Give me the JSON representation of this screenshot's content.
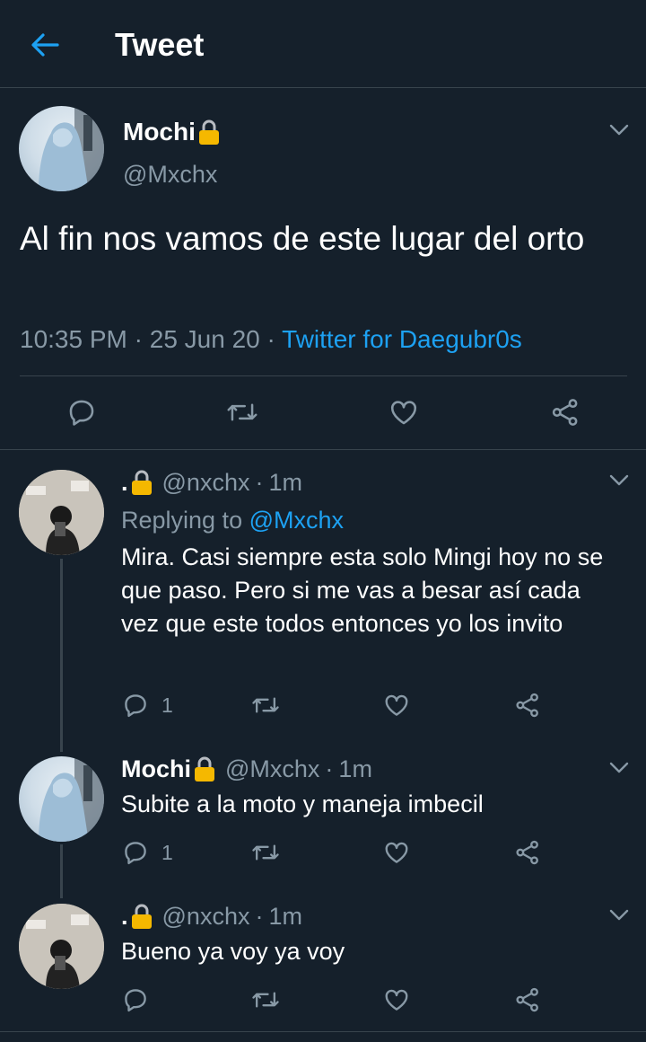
{
  "header": {
    "title": "Tweet",
    "back_icon": "arrow-left-icon"
  },
  "main_tweet": {
    "name": "Mochi",
    "handle": "@Mxchx",
    "text": "Al fin nos vamos de este lugar del orto",
    "time": "10:35 PM",
    "sep": "·",
    "date": "25 Jun 20",
    "source": "Twitter for Daegubr0s"
  },
  "replies": [
    {
      "name": ".",
      "handle": "@nxchx",
      "time": "1m",
      "replying_label": "Replying to",
      "replying_to": "@Mxchx",
      "text": "Mira. Casi siempre esta solo Mingi hoy no se que paso. Pero si me vas a besar así cada vez que este todos entonces yo los invito",
      "reply_count": "1"
    },
    {
      "name": "Mochi",
      "handle": "@Mxchx",
      "time": "1m",
      "text": "Subite a la moto y maneja imbecil",
      "reply_count": "1"
    },
    {
      "name": ".",
      "handle": "@nxchx",
      "time": "1m",
      "text": "Bueno ya voy ya voy",
      "reply_count": ""
    }
  ],
  "colors": {
    "background": "#15202b",
    "accent": "#1da1f2",
    "secondary_text": "#8899a6",
    "divider": "#38444d",
    "lock": "#f5b800"
  }
}
